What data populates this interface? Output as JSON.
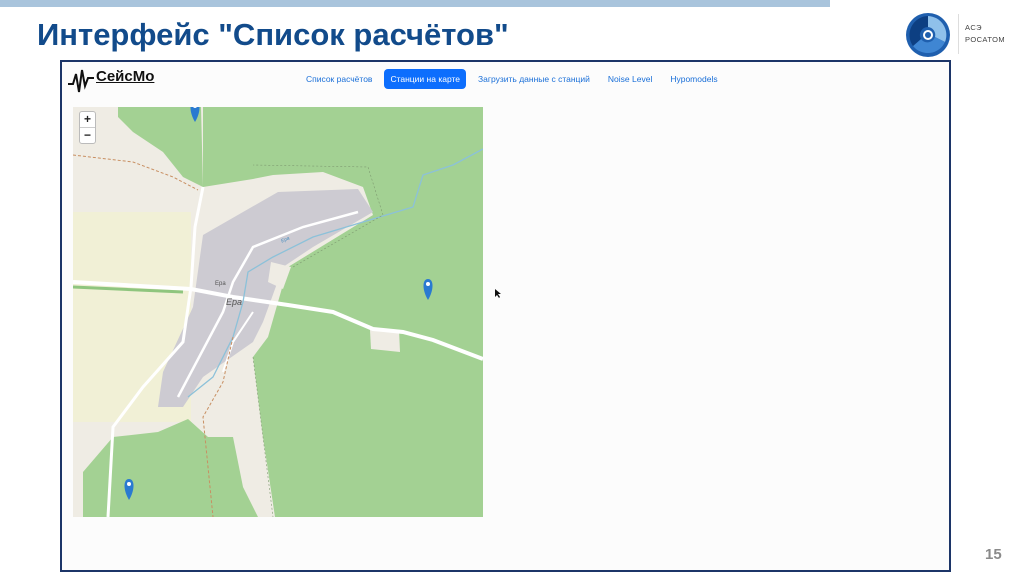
{
  "slide": {
    "title": "Интерфейс \"Список расчётов\"",
    "page_number": "15",
    "logo_text": [
      "АСЭ",
      "РОСАТОМ"
    ],
    "accent_color": "#124b8b"
  },
  "app": {
    "brand": "СейсМо",
    "nav": [
      {
        "label": "Список расчётов",
        "active": false
      },
      {
        "label": "Станции на карте",
        "active": true
      },
      {
        "label": "Загрузить данные с станций",
        "active": false
      },
      {
        "label": "Noise Level",
        "active": false
      },
      {
        "label": "Hypomodels",
        "active": false
      }
    ],
    "nav_active_color": "#0d6efd"
  },
  "map": {
    "zoom_in": "+",
    "zoom_out": "−",
    "labels": {
      "village": "Ера",
      "village_small": "Ера",
      "river": "Ера"
    },
    "markers": 3,
    "marker_icon": "map-pin-icon"
  }
}
